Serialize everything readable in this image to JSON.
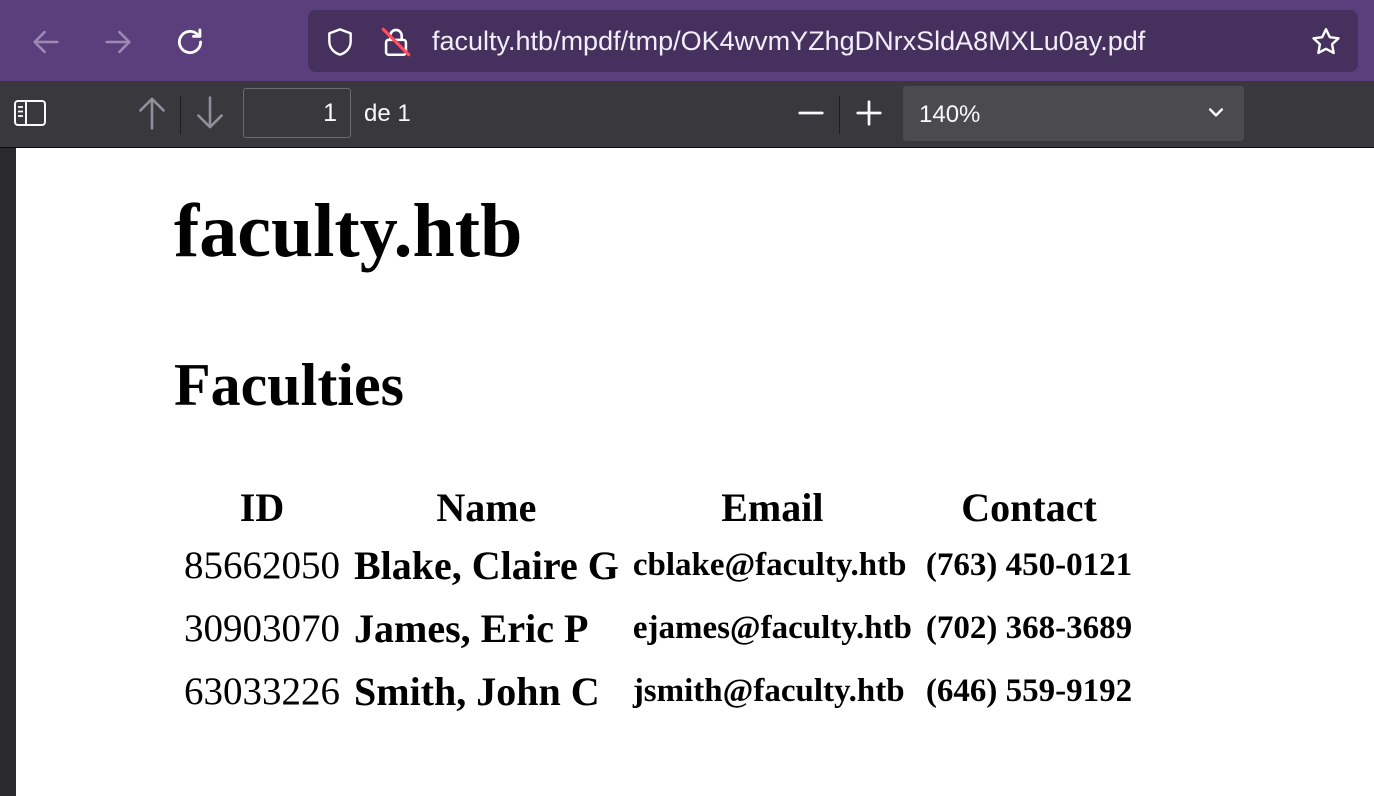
{
  "browser": {
    "url": "faculty.htb/mpdf/tmp/OK4wvmYZhgDNrxSldA8MXLu0ay.pdf",
    "icons": [
      "back-arrow-icon",
      "forward-arrow-icon",
      "reload-icon",
      "shield-icon",
      "insecure-lock-icon",
      "bookmark-star-icon"
    ],
    "colors": {
      "frame": "#5b3f7d",
      "urlbar": "#45305e"
    }
  },
  "pdf_toolbar": {
    "page_number": "1",
    "page_count_label": "de 1",
    "zoom_level": "140%",
    "icons": [
      "sidebar-toggle-icon",
      "previous-page-icon",
      "next-page-icon",
      "zoom-out-icon",
      "zoom-in-icon",
      "chevron-down-icon"
    ]
  },
  "document": {
    "title": "faculty.htb",
    "subtitle": "Faculties",
    "table": {
      "headers": [
        "ID",
        "Name",
        "Email",
        "Contact"
      ],
      "rows": [
        [
          "85662050",
          "Blake, Claire G",
          "cblake@faculty.htb",
          "(763) 450-0121"
        ],
        [
          "30903070",
          "James, Eric P",
          "ejames@faculty.htb",
          "(702) 368-3689"
        ],
        [
          "63033226",
          "Smith, John C",
          "jsmith@faculty.htb",
          "(646) 559-9192"
        ]
      ]
    }
  }
}
